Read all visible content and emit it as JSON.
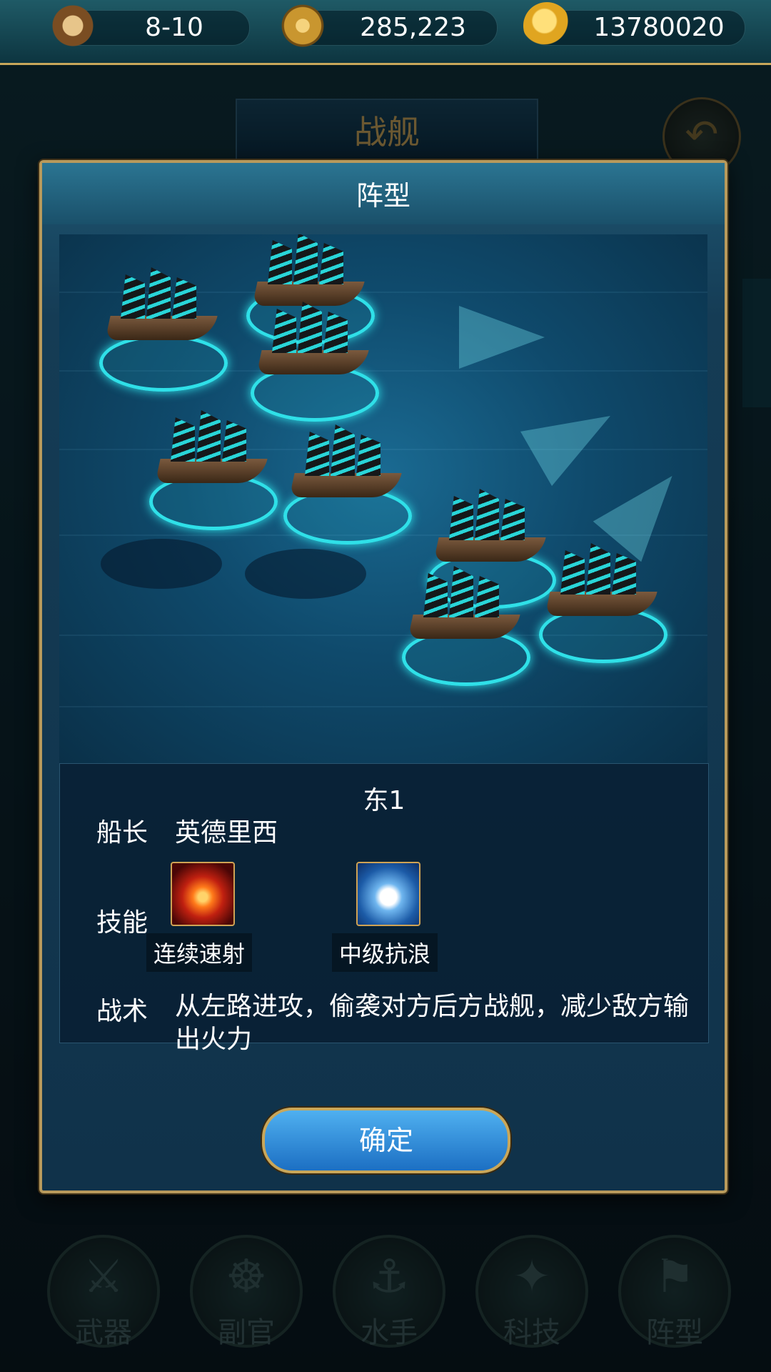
{
  "resources": [
    {
      "icon": "hourglass-icon",
      "value": "8-10"
    },
    {
      "icon": "compass-icon",
      "value": "285,223"
    },
    {
      "icon": "anchor-coin-icon",
      "value": "13780020"
    }
  ],
  "background": {
    "title": "战舰"
  },
  "dialog": {
    "title": "阵型",
    "ship_name": "东1",
    "captain_label": "船长",
    "captain_value": "英德里西",
    "skill_label": "技能",
    "skills": [
      {
        "icon": "rapid-fire-skill-icon",
        "name": "连续速射"
      },
      {
        "icon": "wave-resist-skill-icon",
        "name": "中级抗浪"
      }
    ],
    "tactic_label": "战术",
    "tactic_text": "从左路进攻，偷袭对方后方战舰，减少敌方输出火力",
    "confirm_label": "确定"
  },
  "nav": [
    {
      "icon": "sword-icon",
      "label": "武器"
    },
    {
      "icon": "ship-wheel-icon",
      "label": "副官"
    },
    {
      "icon": "hook-icon",
      "label": "水手"
    },
    {
      "icon": "compass-icon",
      "label": "科技"
    },
    {
      "icon": "flag-icon",
      "label": "阵型"
    }
  ],
  "colors": {
    "accent_gold": "#c9a75a",
    "ring_cyan": "#2fe0e8",
    "button_blue": "#1c6fc3"
  }
}
